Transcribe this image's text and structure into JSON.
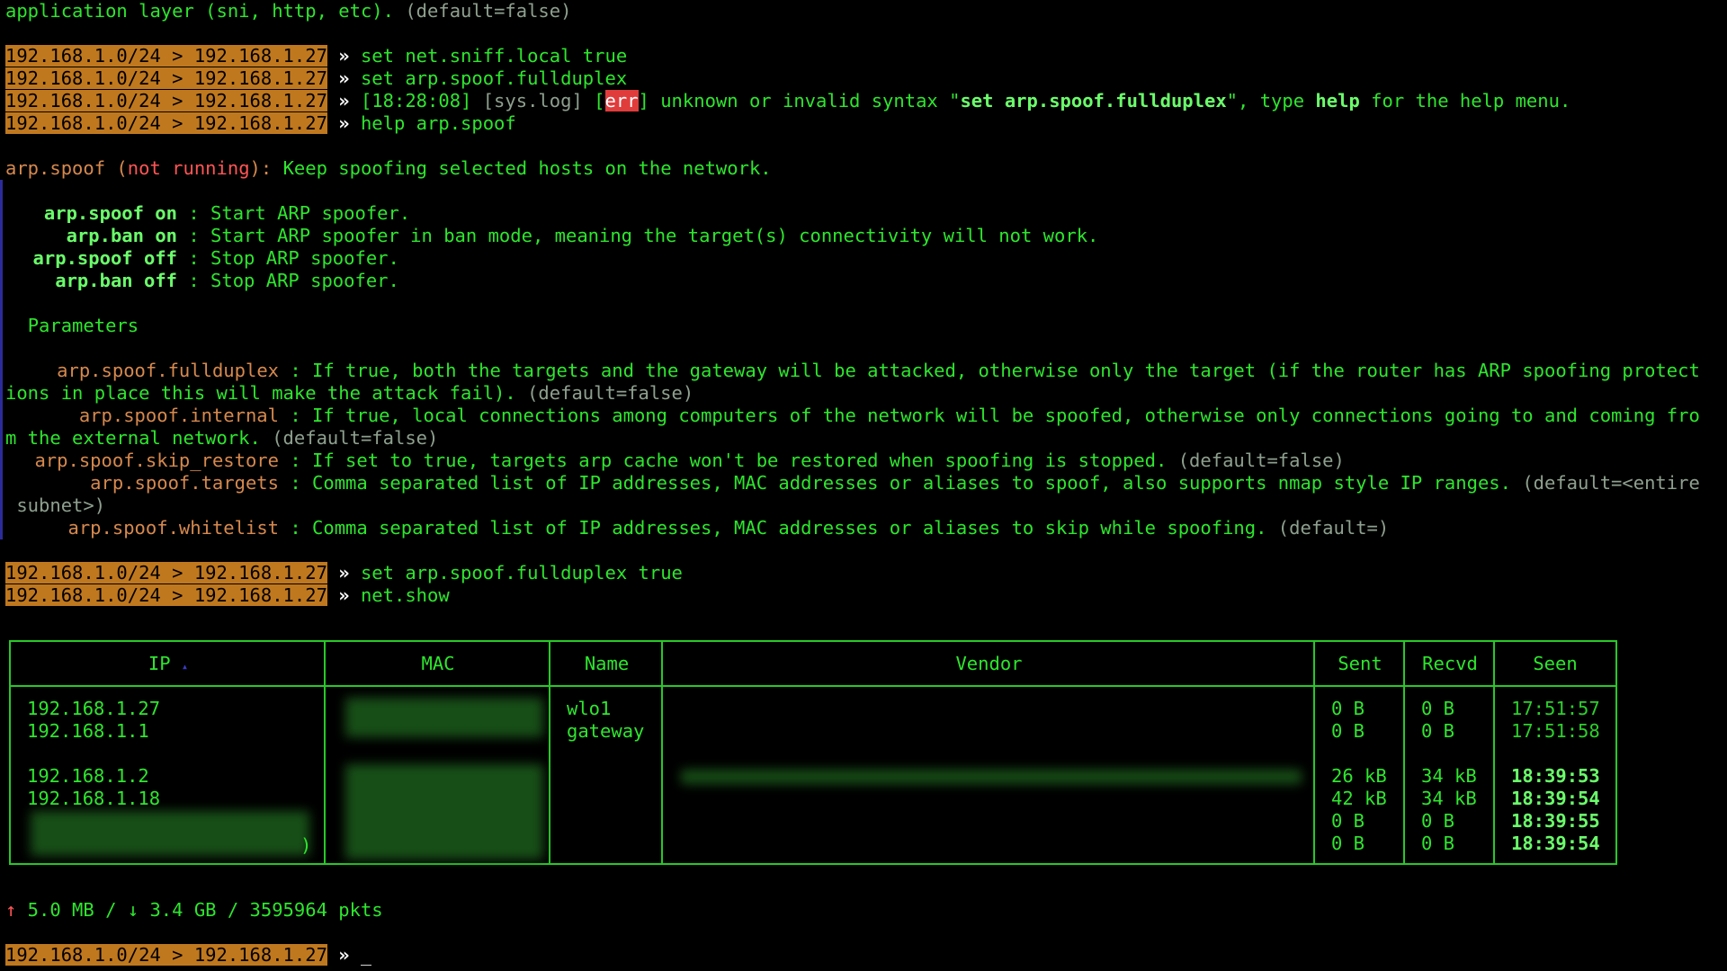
{
  "top_line": "application layer (sni, http, etc). ",
  "top_default": "(default=false)",
  "prompt": "192.168.1.0/24 > 192.168.1.27",
  "arrow": "»",
  "cmd1": "set net.sniff.local true",
  "cmd2": "set arp.spoof.fullduplex",
  "log": {
    "time": "[18:28:08]",
    "tag": "[sys.log]",
    "lb": "[",
    "err": "err",
    "rb": "]",
    "msg1": " unknown or invalid syntax \"",
    "cmd": "set arp.spoof.fullduplex",
    "msg2": "\", type ",
    "help": "help",
    "msg3": " for the help menu."
  },
  "cmd3": "help arp.spoof",
  "help": {
    "module": "arp.spoof",
    "status_open": " (",
    "status": "not running",
    "status_close": "): ",
    "description": "Keep spoofing selected hosts on the network.",
    "commands": [
      {
        "name": "arp.spoof on",
        "desc": " : Start ARP spoofer."
      },
      {
        "name": "arp.ban on",
        "desc": " : Start ARP spoofer in ban mode, meaning the target(s) connectivity will not work."
      },
      {
        "name": "arp.spoof off",
        "desc": " : Stop ARP spoofer."
      },
      {
        "name": "arp.ban off",
        "desc": " : Stop ARP spoofer."
      }
    ],
    "parameters_label": "Parameters",
    "parameters": [
      {
        "name": "arp.spoof.fullduplex",
        "desc": " : If true, both the targets and the gateway will be attacked, otherwise only the target (if the router has ARP spoofing protect",
        "cont": "ions in place this will make the attack fail). ",
        "default": "(default=false)"
      },
      {
        "name": "arp.spoof.internal",
        "desc": " : If true, local connections among computers of the network will be spoofed, otherwise only connections going to and coming fro",
        "cont": "m the external network. ",
        "default": "(default=false)"
      },
      {
        "name": "arp.spoof.skip_restore",
        "desc": " : If set to true, targets arp cache won't be restored when spoofing is stopped. ",
        "cont": "",
        "default": "(default=false)"
      },
      {
        "name": "arp.spoof.targets",
        "desc": " : Comma separated list of IP addresses, MAC addresses or aliases to spoof, also supports nmap style IP ranges. ",
        "desc_default": "(default=<entire",
        "cont": "",
        "default": " subnet>)"
      },
      {
        "name": "arp.spoof.whitelist",
        "desc": " : Comma separated list of IP addresses, MAC addresses or aliases to skip while spoofing. ",
        "cont": "",
        "default": "(default=)"
      }
    ]
  },
  "cmd4": "set arp.spoof.fullduplex true",
  "cmd5": "net.show",
  "table": {
    "headers": [
      "IP",
      "MAC",
      "Name",
      "Vendor",
      "Sent",
      "Recvd",
      "Seen"
    ],
    "sort_icon": "▴",
    "rows": [
      {
        "ip": "192.168.1.27",
        "name": "wlo1",
        "sent": "0 B",
        "recvd": "0 B",
        "seen": "17:51:57"
      },
      {
        "ip": "192.168.1.1",
        "name": "gateway",
        "sent": "0 B",
        "recvd": "0 B",
        "seen": "17:51:58"
      },
      {
        "ip": "192.168.1.2",
        "name": "",
        "sent": "26 kB",
        "recvd": "34 kB",
        "seen": "18:39:53"
      },
      {
        "ip": "192.168.1.18",
        "name": "",
        "sent": "42 kB",
        "recvd": "34 kB",
        "seen": "18:39:54"
      },
      {
        "ip": "",
        "name": "",
        "sent": "0 B",
        "recvd": "0 B",
        "seen": "18:39:55"
      },
      {
        "ip": "",
        "name": "",
        "sent": "0 B",
        "recvd": "0 B",
        "seen": "18:39:54"
      }
    ],
    "partial_char": ")"
  },
  "stats": {
    "up_arrow": "↑",
    "up": " 5.0 MB / ",
    "down_arrow": "↓",
    "down": " 3.4 GB / 3595964 pkts"
  },
  "cursor": "_",
  "colors": {
    "text": "#2ee62e",
    "prompt_bg": "#c0781e",
    "error_bg": "#e03c3c",
    "module_name": "#d6894e",
    "not_running": "#ff5555"
  }
}
